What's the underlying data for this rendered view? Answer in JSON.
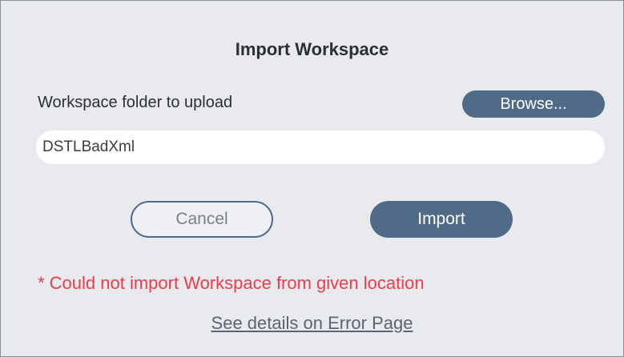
{
  "dialog": {
    "title": "Import Workspace",
    "folder_label": "Workspace folder to upload",
    "browse_label": "Browse...",
    "folder_value": "DSTLBadXml",
    "cancel_label": "Cancel",
    "import_label": "Import",
    "error_message": "* Could not import Workspace from given location",
    "details_link": "See details on Error Page"
  },
  "colors": {
    "primary_button": "#4f6b88",
    "error_text": "#f03a4a",
    "background": "#e8eaee"
  }
}
